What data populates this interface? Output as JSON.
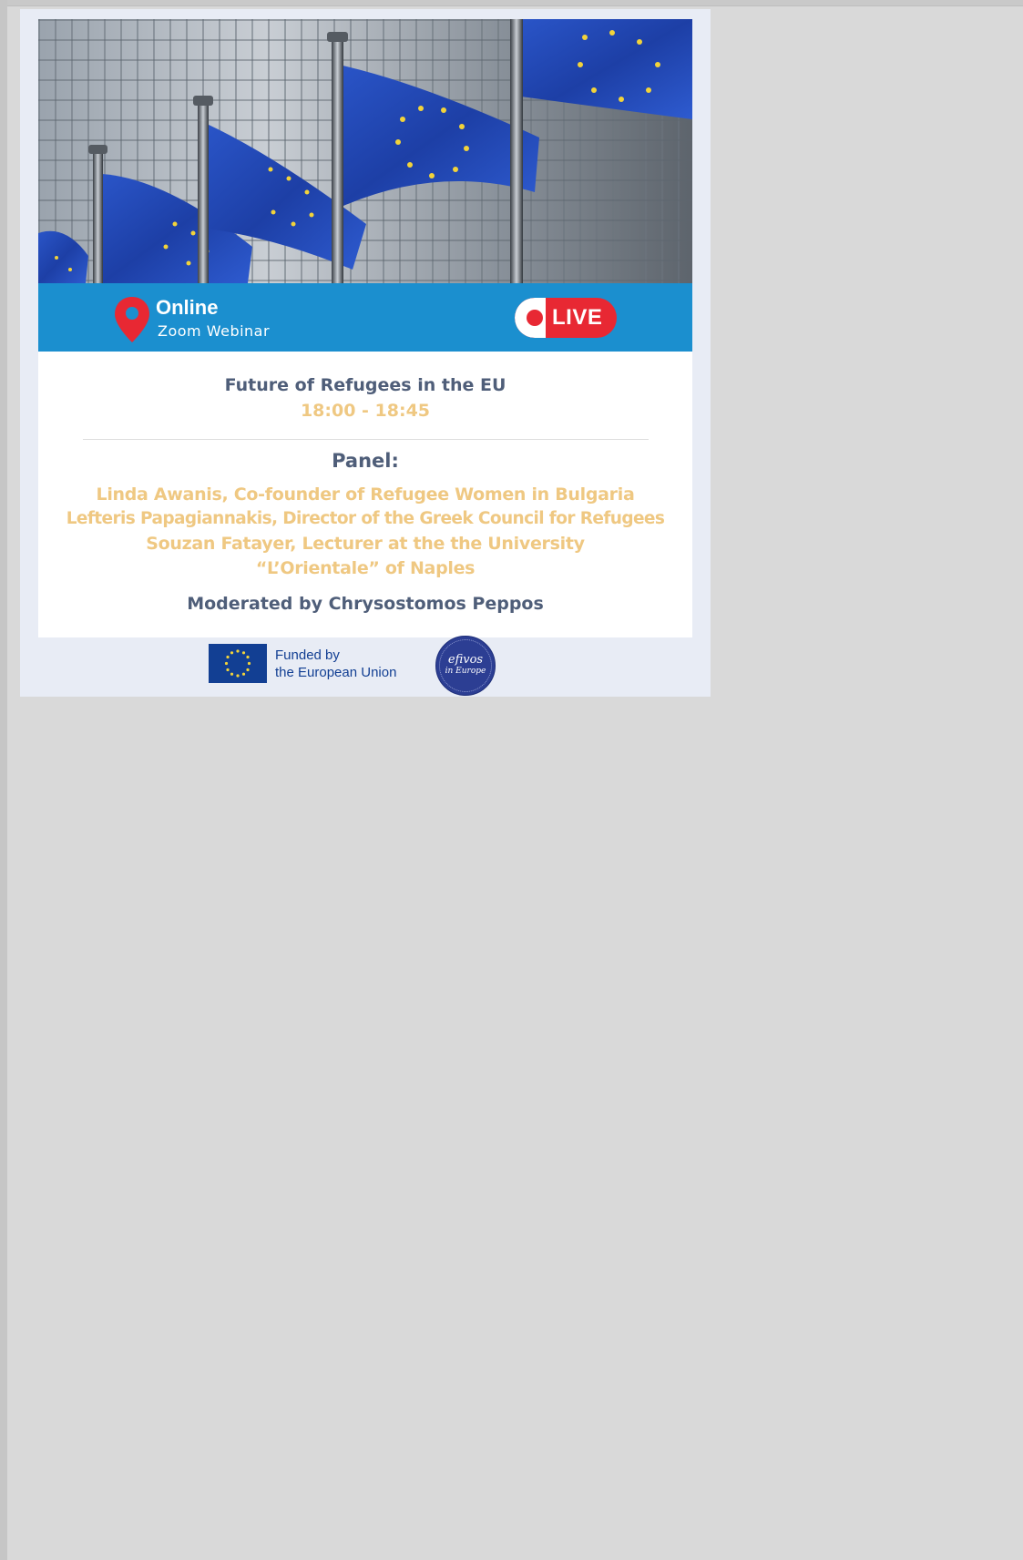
{
  "banner": {
    "location_title": "Online",
    "location_subtitle": "Zoom Webinar",
    "live_label": "LIVE"
  },
  "event": {
    "title": "Future of Refugees in the EU",
    "time": "18:00 - 18:45",
    "panel_label": "Panel:",
    "panelists": [
      "Linda Awanis, Co-founder of Refugee Women in Bulgaria",
      "Lefteris Papagiannakis, Director of the Greek Council for Refugees",
      "Souzan Fatayer, Lecturer at the the University",
      "“L’Orientale” of Naples"
    ],
    "moderator": "Moderated by Chrysostomos Peppos"
  },
  "footer": {
    "funded_line1": "Funded by",
    "funded_line2": "the European Union",
    "partner_logo_line1": "efivos",
    "partner_logo_line2": "in Europe"
  },
  "colors": {
    "banner_blue": "#1b8fcf",
    "live_red": "#e82833",
    "heading_navy": "#4f5e79",
    "accent_gold": "#efc882",
    "eu_blue": "#123f93"
  }
}
